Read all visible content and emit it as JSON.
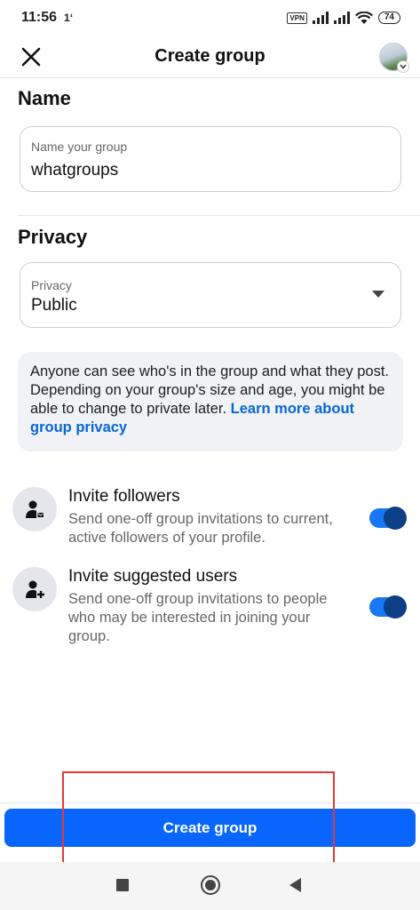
{
  "status_bar": {
    "time": "11:56",
    "extra": "1‘",
    "vpn": "VPN",
    "battery": "74"
  },
  "header": {
    "title": "Create group",
    "close_icon": "close-icon",
    "avatar": "profile-avatar"
  },
  "name_section": {
    "heading": "Name",
    "label": "Name your group",
    "value": "whatgroups"
  },
  "privacy_section": {
    "heading": "Privacy",
    "label": "Privacy",
    "value": "Public",
    "info_text": "Anyone can see who's in the group and what they post. Depending on your group's size and age, you might be able to change to private later. ",
    "info_link": "Learn more about group privacy"
  },
  "invites": [
    {
      "title": "Invite followers",
      "description": "Send one-off group invitations to current, active followers of your profile.",
      "enabled": true,
      "icon": "person-follow-icon"
    },
    {
      "title": "Invite suggested users",
      "description": "Send one-off group invitations to people who may be interested in joining your group.",
      "enabled": true,
      "icon": "person-add-icon"
    }
  ],
  "footer": {
    "create_label": "Create group"
  },
  "colors": {
    "primary": "#0866ff",
    "toggle_on": "#1877f2",
    "link": "#0866d6",
    "highlight": "#e53935"
  }
}
